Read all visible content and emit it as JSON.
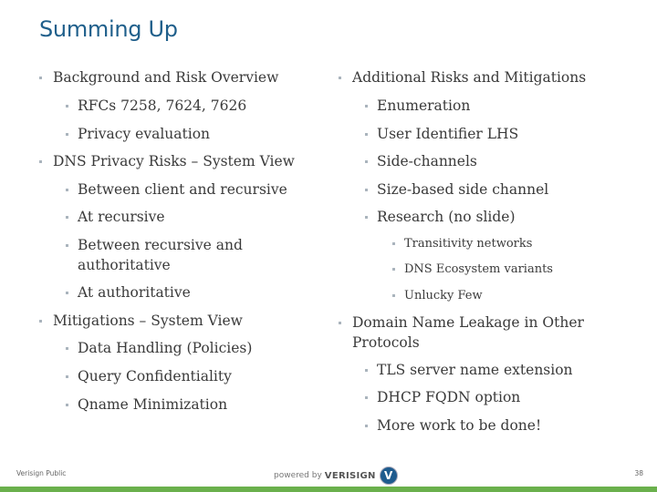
{
  "slide": {
    "title": "Summing Up",
    "left_column": [
      {
        "text": "Background and Risk Overview",
        "children": [
          "RFCs 7258, 7624, 7626",
          "Privacy evaluation"
        ]
      },
      {
        "text": "DNS Privacy Risks – System View",
        "children": [
          "Between client and recursive",
          "At recursive",
          "Between recursive and authoritative",
          "At authoritative"
        ]
      },
      {
        "text": "Mitigations – System View",
        "children": [
          "Data Handling (Policies)",
          "Query Confidentiality",
          "Qname Minimization"
        ]
      }
    ],
    "right_column": [
      {
        "text": "Additional Risks and Mitigations",
        "children": [
          "Enumeration",
          "User Identifier LHS",
          "Side-channels",
          "Size-based side channel",
          "Research (no slide)"
        ],
        "grandchildren": [
          "Transitivity networks",
          "DNS Ecosystem variants",
          "Unlucky Few"
        ]
      },
      {
        "text": "Domain Name Leakage in Other Protocols",
        "children": [
          "TLS server name extension",
          "DHCP FQDN option",
          "More work to be done!"
        ]
      }
    ]
  },
  "footer": {
    "classification": "Verisign Public",
    "powered_by": "powered by",
    "brand": "VERISIGN",
    "logo_glyph": "V",
    "page_number": "38"
  },
  "colors": {
    "title": "#1f5f8b",
    "bottom_bar": "#6ab04c"
  }
}
